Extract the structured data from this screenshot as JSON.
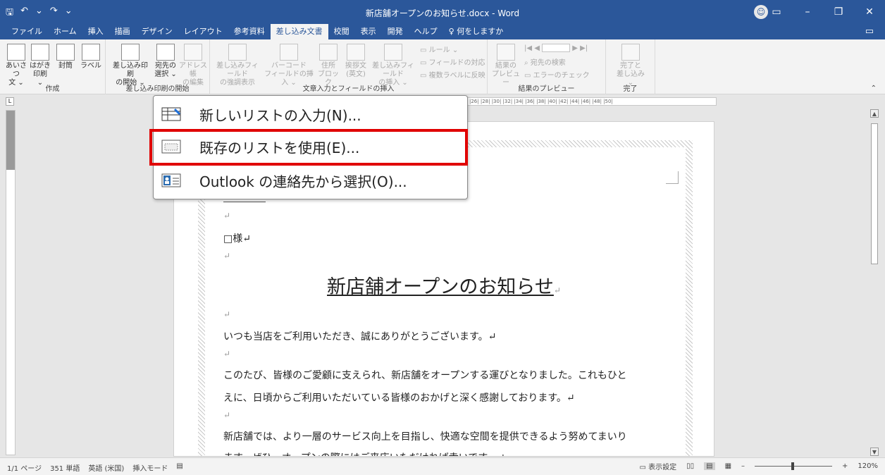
{
  "titlebar": {
    "doc_title": "新店舗オープンのお知らせ.docx - Word",
    "qat": [
      "🖫",
      "↶",
      "⌄",
      "↷",
      "⌄"
    ],
    "ctrls": [
      "▭",
      "–",
      "❐",
      "✕"
    ]
  },
  "tabs": [
    "ファイル",
    "ホーム",
    "挿入",
    "描画",
    "デザイン",
    "レイアウト",
    "参考資料",
    "差し込み文書",
    "校閲",
    "表示",
    "開発",
    "ヘルプ",
    "♀ 何をしますか"
  ],
  "ribbon": {
    "groups": {
      "create": "作成",
      "start_merge": "差し込み印刷の開始",
      "write_insert": "文章入力とフィールドの挿入",
      "preview": "結果のプレビュー",
      "finish": "完了"
    },
    "buttons": {
      "greeting": "あいさつ\n文 ⌄",
      "postcard": "はがき\n印刷 ⌄",
      "envelope": "封筒",
      "label": "ラベル",
      "start_merge": "差し込み印刷\nの開始 ⌄",
      "select_recipients": "宛先の\n選択 ⌄",
      "address_book": "アドレス帳\nの編集",
      "highlight_fields": "差し込みフィールド\nの強調表示",
      "barcode": "バーコード\nフィールドの挿入 ⌄",
      "address_block": "住所\nブロック",
      "greeting_line": "挨拶文\n(英文)",
      "insert_merge_field": "差し込みフィールド\nの挿入 ⌄",
      "rules": "ルール ⌄",
      "match_fields": "フィールドの対応",
      "update_labels": "複数ラベルに反映",
      "preview_results": "結果の\nプレビュー",
      "find_recipient": "宛先の検索",
      "check_errors": "エラーのチェック",
      "finish_merge": "完了と\n差し込み ⌄"
    }
  },
  "ruler_marks": "|26| |28| |30| |32| |34| |36| |38| |40| |42| |44| |46| |48| |50|",
  "menu": {
    "items": [
      {
        "label": "新しいリストの入力(N)..."
      },
      {
        "label": "既存のリストを使用(E)..."
      },
      {
        "label": "Outlook の連絡先から選択(O)..."
      }
    ]
  },
  "document": {
    "line_empty1": "↵",
    "line_sama": "□様↵",
    "line_empty2": "↵",
    "heading": "新店舗オープンのお知らせ",
    "heading_mark": "↵",
    "line_empty3": "↵",
    "p1": "いつも当店をご利用いただき、誠にありがとうございます。↵",
    "line_empty4": "↵",
    "p2a": "このたび、皆様のご愛顧に支えられ、新店舗をオープンする運びとなりました。これもひと",
    "p2b": "えに、日頃からご利用いただいている皆様のおかげと深く感謝しております。↵",
    "line_empty5": "↵",
    "p3a": "新店舗では、より一層のサービス向上を目指し、快適な空間を提供できるよう努めてまいり",
    "p3b": "ます。ぜひ、オープンの際にはご来店いただければ幸いです。↵"
  },
  "statusbar": {
    "page": "1/1 ページ",
    "words": "351 単語",
    "lang": "英語 (米国)",
    "mode": "挿入モード",
    "display_settings": "表示設定",
    "zoom": "120%"
  }
}
